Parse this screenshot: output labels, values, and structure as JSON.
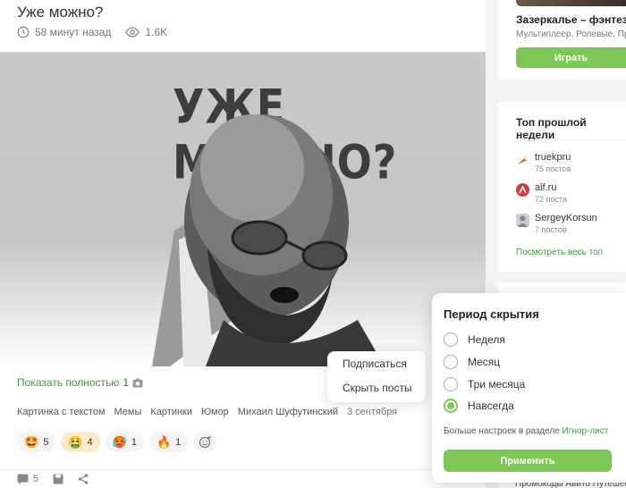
{
  "post": {
    "title": "Уже можно?",
    "time": "58 минут назад",
    "views": "1.6K",
    "image_text": "УЖЕ МОЖНО?",
    "show_full": "Показать полностью",
    "image_count": "1",
    "tags": [
      "Картинка с текстом",
      "Мемы",
      "Картинки",
      "Юмор",
      "Михаил Шуфутинский"
    ],
    "date": "3 сентября",
    "reactions": [
      {
        "emoji": "🤩",
        "count": "5"
      },
      {
        "emoji": "🤮",
        "count": "4"
      },
      {
        "emoji": "🥵",
        "count": "1"
      },
      {
        "emoji": "🔥",
        "count": "1"
      }
    ],
    "comments_count": "5"
  },
  "context_menu": {
    "subscribe": "Подписаться",
    "hide_posts": "Скрыть посты"
  },
  "sidebar": {
    "game": {
      "name": "Зазеркалье – фэнтези М",
      "genres": "Мультиплеер, Ролевые, При",
      "play": "Играть"
    },
    "top_week": {
      "title": "Топ прошлой недели",
      "users": [
        {
          "name": "truekpru",
          "posts": "75 постов",
          "color": "#e0683a"
        },
        {
          "name": "aif.ru",
          "posts": "72 поста",
          "color": "#d23b3b"
        },
        {
          "name": "SergeyKorsun",
          "posts": "7 постов",
          "color": "#9aa3ad"
        }
      ],
      "see_all": "Посмотреть весь топ"
    },
    "promo": "Промокоды Авито Путешест"
  },
  "hide_popup": {
    "title": "Период скрытия",
    "options": [
      "Неделя",
      "Месяц",
      "Три месяца",
      "Навсегда"
    ],
    "selected": "Навсегда",
    "more_text": "Больше настроек в разделе",
    "more_link": "Игнор-лист",
    "apply": "Применить"
  },
  "colors": {
    "accent": "#7cc756",
    "link": "#3f9a3f"
  }
}
